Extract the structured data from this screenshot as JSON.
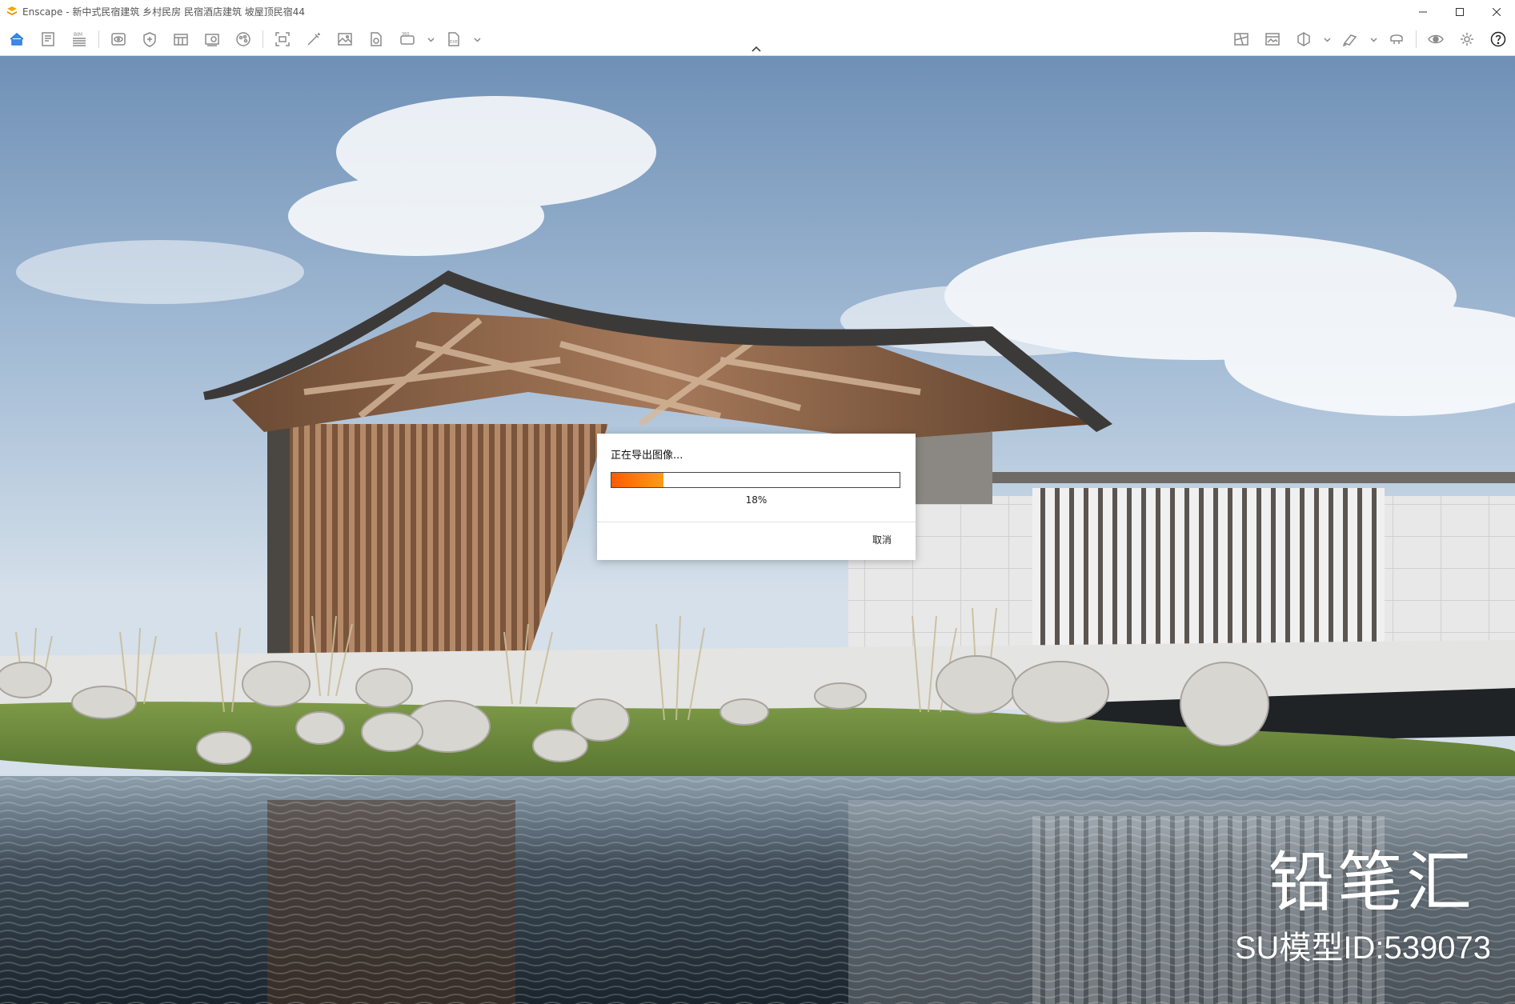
{
  "window": {
    "title": "Enscape - 新中式民宿建筑 乡村民房 民宿酒店建筑 坡屋顶民宿44",
    "controls": [
      "minimize",
      "maximize",
      "close"
    ]
  },
  "toolbar": {
    "left_tools": [
      {
        "icon": "home-icon",
        "active": true
      },
      {
        "icon": "document-icon"
      },
      {
        "icon": "bim-icon",
        "label": "BIM"
      },
      {
        "icon": "view-icon"
      },
      {
        "icon": "asset-library-icon"
      },
      {
        "icon": "views-manager-icon"
      },
      {
        "icon": "material-editor-icon"
      },
      {
        "icon": "atmosphere-icon"
      },
      {
        "icon": "screenshot-icon"
      },
      {
        "icon": "batch-render-icon"
      },
      {
        "icon": "image-icon"
      },
      {
        "icon": "panorama-icon"
      },
      {
        "icon": "video-360-icon",
        "label": "360"
      },
      {
        "icon": "export-exe-icon",
        "label": "EXE"
      }
    ],
    "right_tools": [
      {
        "icon": "map-icon"
      },
      {
        "icon": "render-window-icon"
      },
      {
        "icon": "cube-icon"
      },
      {
        "icon": "collaborative-annotation-icon"
      },
      {
        "icon": "vr-headset-icon"
      },
      {
        "icon": "visual-settings-icon"
      },
      {
        "icon": "settings-gear-icon"
      },
      {
        "icon": "help-icon"
      }
    ]
  },
  "dialog": {
    "title": "正在导出图像...",
    "progress": 0.18,
    "progress_text": "18%",
    "cancel_label": "取消"
  },
  "overlay": {
    "brand": "铅笔汇",
    "model_id": "SU模型ID:539073"
  },
  "colors": {
    "progress_start": "#ff5a00",
    "progress_end": "#ff9c1a",
    "active_icon": "#2a7de1"
  }
}
